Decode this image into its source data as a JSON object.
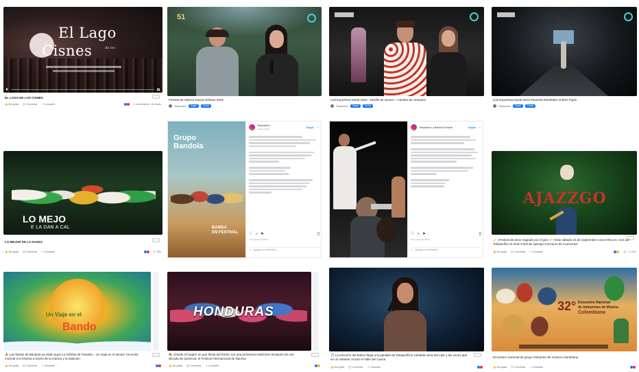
{
  "colors": {
    "fb_blue": "#1877f2",
    "meta_text": "#65676b"
  },
  "tiles": {
    "lago": {
      "overlay_line1": "El Lago",
      "overlay_line2": "Cisnes",
      "overlay_small": "de los",
      "caption": "EL LAGO DE LOS CISNES"
    },
    "tv1": {
      "channel_badge": "51",
      "caption": "Festival de Música Nueva Orleans 2023"
    },
    "tv2": {
      "caption": "Cali Exposhow Moda 2023 - Desfile de verano + Cambio de vestuario"
    },
    "tv3": {
      "caption": "Cali Exposhow Moda 2023 Pasarela Diseñador Andrés Pajón"
    },
    "bandola": {
      "poster_title": "Grupo\nBandola",
      "poster_sub": "BANDA\nEN FESTIVAL",
      "ig_account": "Telepacífico",
      "ig_sub": "Audio original",
      "ig_follow": "Seguir",
      "ig_comment_placeholder": "Agrega un comentario...",
      "ig_date": "7 de agosto de 2023"
    },
    "orchestra": {
      "ig_account": "Telepacífico y Bandola Festival",
      "ig_follow": "Seguir",
      "ig_comment_placeholder": "Agrega un comentario...",
      "ig_date": "5 de agosto de 2023"
    },
    "lomejo": {
      "overlay_line1": "LO MEJO",
      "overlay_line2": "E LA DAN A   CAL",
      "caption": "LO MEJOR DE LA DANZA"
    },
    "ajazzgo": {
      "overlay": "AJAZZGO",
      "caption": "🎺 ¡Festival de amor sagrado por el jazz 🎷! Este sábado 15 de septiembre a las 8:00 p.m. vive por Telepacífico la Gran Final de Ajazzgo Concurso de Conciertos"
    },
    "fiesta": {
      "overlay_line1": "Un Viaje en el",
      "overlay_line2": "Bando",
      "caption": "🎉 Las fiestas de Bandola ya están aquí! La Orfesta de Fandola – Un viaje en el tiempo' recorrido musical a la historia a través de la música y la tradición"
    },
    "honduras": {
      "overlay": "HONDURAS",
      "caption": "🎭 ¡Desde el hogar!! en que fiesta del folclor con una presencia multicolor! Después de una década de ausencia, el Festival Internacional de Danzas"
    },
    "singer": {
      "caption": "🎵 La emoción del Bolero llega a la pantalla de Telepacífico! Cándida Llera del Latir y las voces que en un instante cruzan el Valle del Cauca"
    },
    "encuentro": {
      "overlay_number": "32°",
      "overlay_line1": "Encuentro Nacional",
      "overlay_line2": "de Intérpretes de Música",
      "overlay_line3": "Colombiana",
      "caption": "Encuentro nacional de grupo Intérprete de música colombiana"
    }
  },
  "labels": {
    "like": "Me gusta",
    "comment": "Comentar",
    "share": "Compartir",
    "follow_chip": "Seguir",
    "send_chip": "Enviar",
    "views_a": "2 comentarios · 84 vistas",
    "views_b": "12 · 2.1 mil",
    "views_c": "8 · 890",
    "tp_name": "Telepacífico",
    "time_tiny": "3 sem"
  }
}
